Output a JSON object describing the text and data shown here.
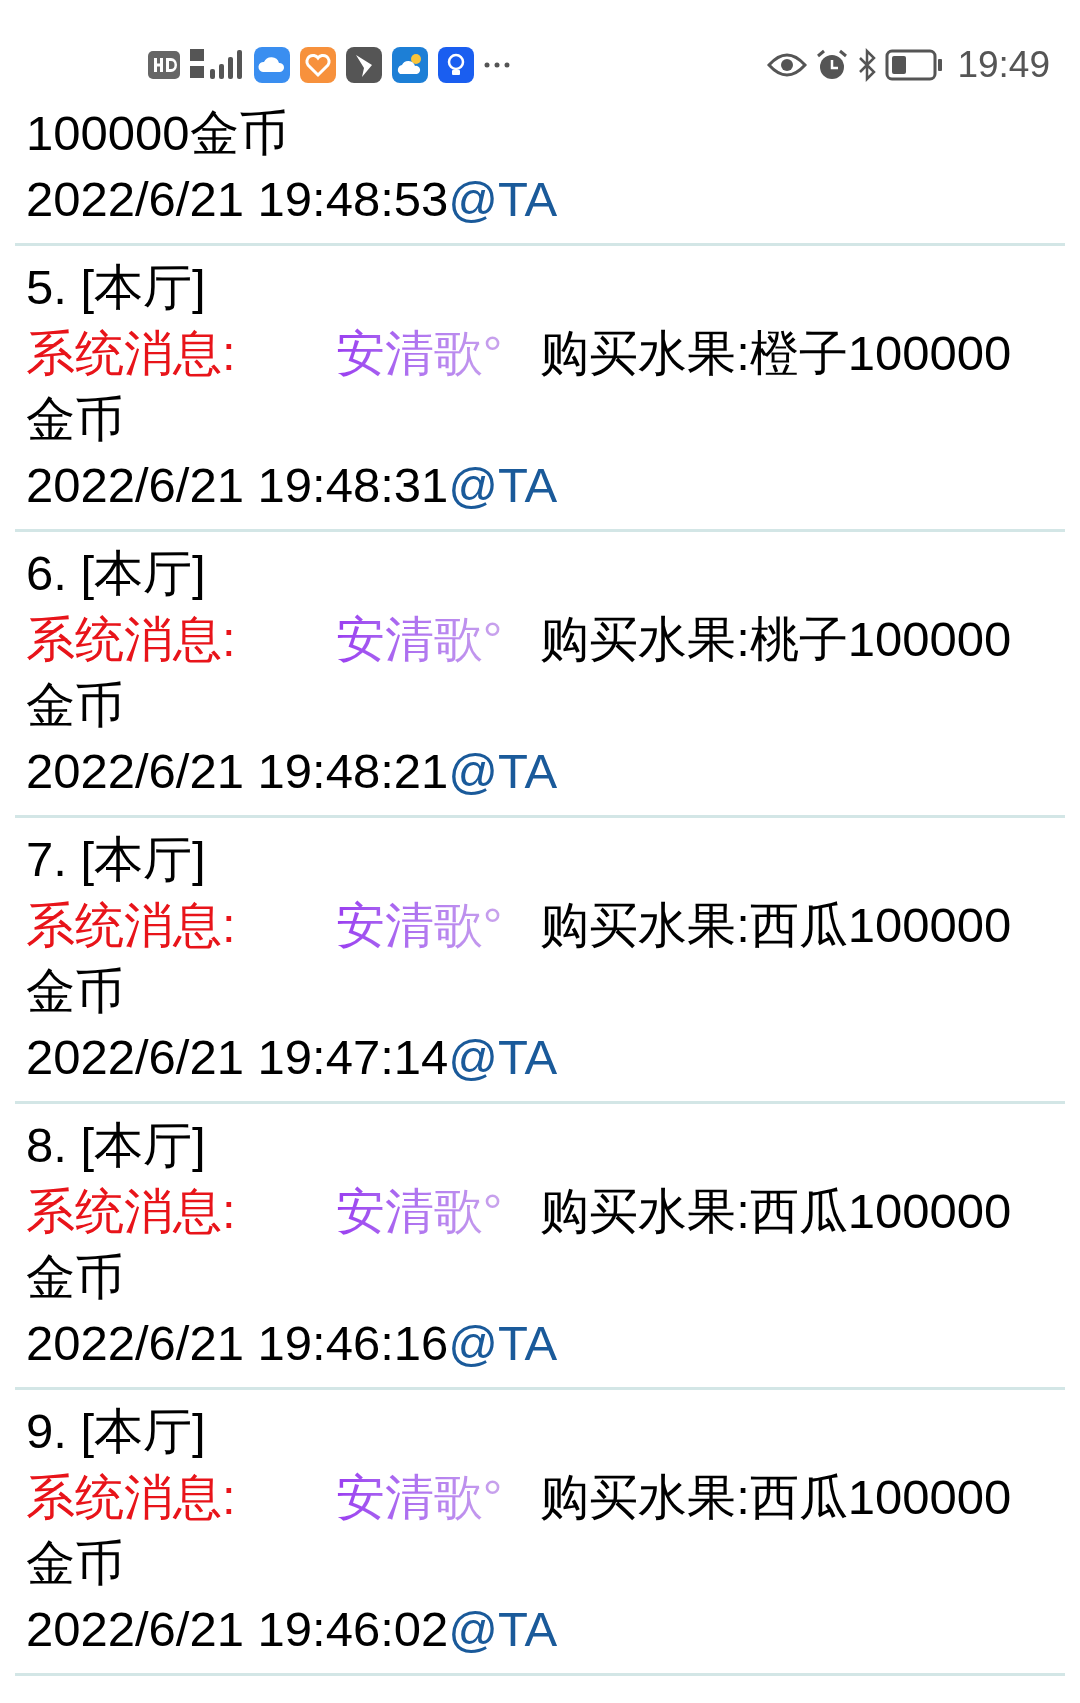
{
  "status_bar": {
    "time": "19:49"
  },
  "top_partial": {
    "lines": [
      "100000金币"
    ],
    "timestamp": "2022/6/21 19:48:53",
    "mention": "@TA"
  },
  "entries": [
    {
      "header": "5. [本厅]",
      "label": "系统消息:",
      "user": "安清歌°",
      "message": "购买水果:橙子100000金币",
      "timestamp": "2022/6/21 19:48:31",
      "mention": "@TA"
    },
    {
      "header": "6. [本厅]",
      "label": "系统消息:",
      "user": "安清歌°",
      "message": "购买水果:桃子100000金币",
      "timestamp": "2022/6/21 19:48:21",
      "mention": "@TA"
    },
    {
      "header": "7. [本厅]",
      "label": "系统消息:",
      "user": "安清歌°",
      "message": "购买水果:西瓜100000金币",
      "timestamp": "2022/6/21 19:47:14",
      "mention": "@TA"
    },
    {
      "header": "8. [本厅]",
      "label": "系统消息:",
      "user": "安清歌°",
      "message": "购买水果:西瓜100000金币",
      "timestamp": "2022/6/21 19:46:16",
      "mention": "@TA"
    },
    {
      "header": "9. [本厅]",
      "label": "系统消息:",
      "user": "安清歌°",
      "message": "购买水果:西瓜100000金币",
      "timestamp": "2022/6/21 19:46:02",
      "mention": "@TA"
    }
  ]
}
